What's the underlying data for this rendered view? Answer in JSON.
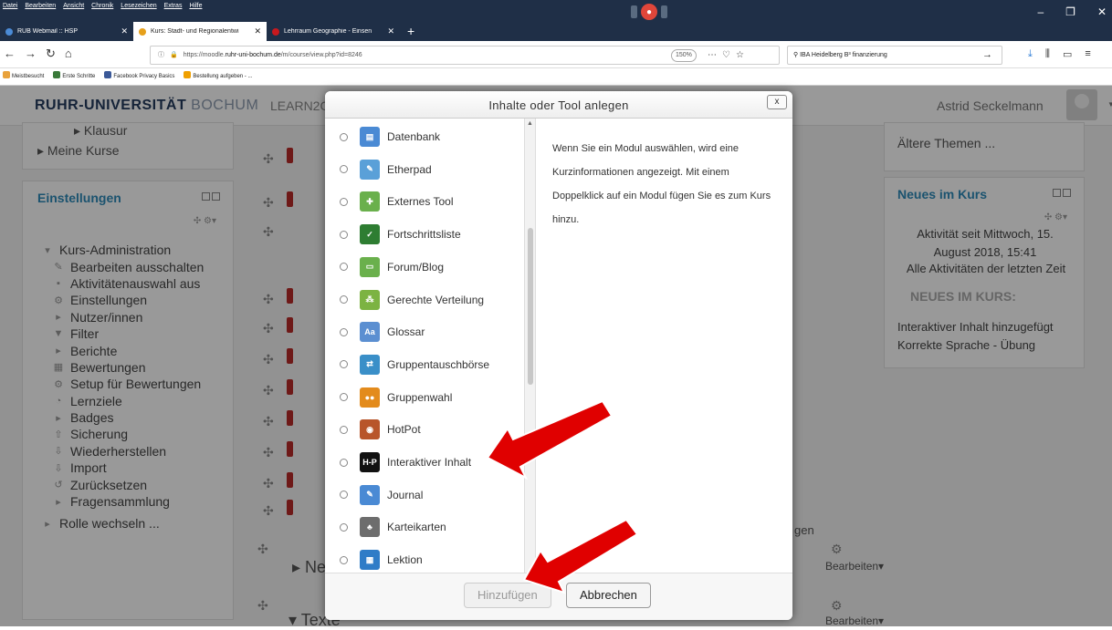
{
  "browser": {
    "menu": [
      "Datei",
      "Bearbeiten",
      "Ansicht",
      "Chronik",
      "Lesezeichen",
      "Extras",
      "Hilfe"
    ],
    "tabs": [
      {
        "title": "RUB Webmail :: HSP"
      },
      {
        "title": "Kurs: Stadt- und Regionalentwi"
      },
      {
        "title": "Lehrraum Geographie - Einsen"
      }
    ],
    "url_prefix": "https://moodle.",
    "url_host": "ruhr-uni-bochum.de",
    "url_path": "/m/course/view.php?id=8246",
    "zoom": "150%",
    "search_value": "IBA Heidelberg B³ finanzierung",
    "bookmarks": [
      "Meistbesucht",
      "Erste Schritte",
      "Facebook Privacy Basics",
      "Bestellung aufgeben - ..."
    ]
  },
  "site": {
    "brand_bold": "RUHR-UNIVERSITÄT",
    "brand_thin": "BOCHUM",
    "nav_item": "LEARN2G",
    "user_name": "Astrid Seckelmann"
  },
  "left": {
    "nav_items": [
      "Klausur",
      "Meine Kurse"
    ],
    "settings_title": "Einstellungen",
    "tree": [
      "Kurs-Administration",
      "Bearbeiten ausschalten",
      "Aktivitätenauswahl aus",
      "Einstellungen",
      "Nutzer/innen",
      "Filter",
      "Berichte",
      "Bewertungen",
      "Setup für Bewertungen",
      "Lernziele",
      "Badges",
      "Sicherung",
      "Wiederherstellen",
      "Import",
      "Zurücksetzen",
      "Fragensammlung",
      "Rolle wechseln ..."
    ]
  },
  "center": {
    "section1": "Ne",
    "section2": "Texte",
    "partial_link": "gen",
    "edit_label": "Bearbeiten",
    "edit_label2": "Bearbeiten"
  },
  "right": {
    "older_topics": "Ältere Themen ...",
    "news_title": "Neues im Kurs",
    "activity_since": "Aktivität seit Mittwoch, 15. August 2018, 15:41",
    "all_activities": "Alle Aktivitäten der letzten Zeit",
    "news_caps": "NEUES IM KURS:",
    "news_item1": "Interaktiver Inhalt hinzugefügt",
    "news_item2": "Korrekte Sprache - Übung"
  },
  "dialog": {
    "title": "Inhalte oder Tool anlegen",
    "close": "x",
    "modules": [
      {
        "name": "Datenbank",
        "icon": "database-icon",
        "color": "#4a8ad4"
      },
      {
        "name": "Etherpad",
        "icon": "etherpad-icon",
        "color": "#5aa0d8"
      },
      {
        "name": "Externes Tool",
        "icon": "puzzle-icon",
        "color": "#6ab04c"
      },
      {
        "name": "Fortschrittsliste",
        "icon": "checklist-icon",
        "color": "#2e7d32"
      },
      {
        "name": "Forum/Blog",
        "icon": "forum-icon",
        "color": "#6ab04c"
      },
      {
        "name": "Gerechte Verteilung",
        "icon": "distribution-icon",
        "color": "#7cb342"
      },
      {
        "name": "Glossar",
        "icon": "glossary-icon",
        "color": "#5b8fd1"
      },
      {
        "name": "Gruppentauschbörse",
        "icon": "exchange-icon",
        "color": "#3a8fc8"
      },
      {
        "name": "Gruppenwahl",
        "icon": "group-choice-icon",
        "color": "#e38b1c"
      },
      {
        "name": "HotPot",
        "icon": "hotpot-icon",
        "color": "#b8552a"
      },
      {
        "name": "Interaktiver Inhalt",
        "icon": "h5p-icon",
        "color": "#111111"
      },
      {
        "name": "Journal",
        "icon": "journal-icon",
        "color": "#4a8ad4"
      },
      {
        "name": "Karteikarten",
        "icon": "flashcards-icon",
        "color": "#6d6d6d"
      },
      {
        "name": "Lektion",
        "icon": "lesson-icon",
        "color": "#2f7cc7"
      }
    ],
    "info_text": "Wenn Sie ein Modul auswählen, wird eine Kurzinformationen angezeigt. Mit einem Doppelklick auf ein Modul fügen Sie es zum Kurs hinzu.",
    "add_button": "Hinzufügen",
    "cancel_button": "Abbrechen"
  },
  "colors": {
    "accent": "#2e8ab9",
    "brand": "#243b5e",
    "arrow": "#e00000"
  }
}
